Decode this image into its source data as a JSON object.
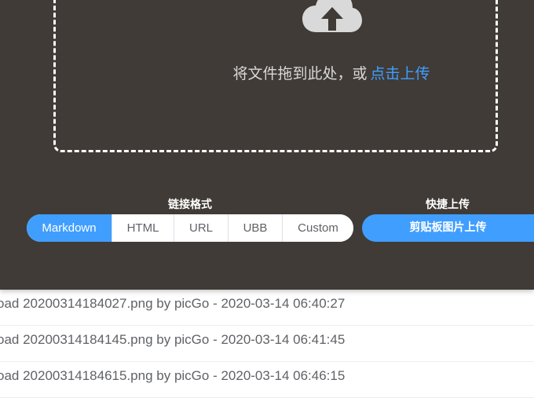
{
  "upload": {
    "drop_text": "将文件拖到此处，或",
    "drop_link": "点击上传",
    "icon": "cloud-upload-icon"
  },
  "link_format": {
    "label": "链接格式",
    "options": [
      "Markdown",
      "HTML",
      "URL",
      "UBB",
      "Custom"
    ],
    "selected": "Markdown"
  },
  "quick_upload": {
    "label": "快捷上传",
    "button": "剪贴板图片上传"
  },
  "log": [
    "oad 20200314184027.png by picGo - 2020-03-14 06:40:27",
    "oad 20200314184145.png by picGo - 2020-03-14 06:41:45",
    "oad 20200314184615.png by picGo - 2020-03-14 06:46:15"
  ],
  "colors": {
    "accent": "#409eff",
    "panel": "#403b36"
  }
}
